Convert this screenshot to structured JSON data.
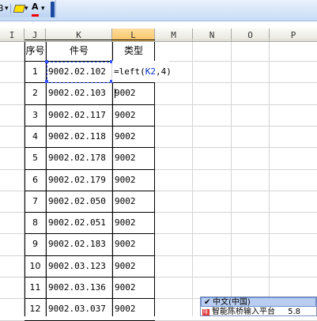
{
  "toolbar": {
    "left_label": "B",
    "font_color_letter": "A",
    "dropdown_arrow": "▾"
  },
  "columns": [
    "I",
    "J",
    "K",
    "L",
    "M",
    "N",
    "O",
    "P"
  ],
  "header_row": {
    "seq": "序号",
    "part": "件号",
    "type": "类型"
  },
  "rows": [
    {
      "seq": "1",
      "part": "9002.02.102",
      "type": ""
    },
    {
      "seq": "2",
      "part": "9002.02.103",
      "type": "9002"
    },
    {
      "seq": "3",
      "part": "9002.02.117",
      "type": "9002"
    },
    {
      "seq": "4",
      "part": "9002.02.118",
      "type": "9002"
    },
    {
      "seq": "5",
      "part": "9002.02.178",
      "type": "9002"
    },
    {
      "seq": "6",
      "part": "9002.02.179",
      "type": "9002"
    },
    {
      "seq": "7",
      "part": "9002.02.050",
      "type": "9002"
    },
    {
      "seq": "8",
      "part": "9002.02.051",
      "type": "9002"
    },
    {
      "seq": "9",
      "part": "9002.02.183",
      "type": "9002"
    },
    {
      "seq": "10",
      "part": "9002.03.123",
      "type": "9002"
    },
    {
      "seq": "11",
      "part": "9002.03.136",
      "type": "9002"
    },
    {
      "seq": "12",
      "part": "9002.03.037",
      "type": "9002"
    }
  ],
  "formula": {
    "prefix": "=left(",
    "ref": "K2",
    "suffix": ",4)"
  },
  "ime": {
    "check": "✔",
    "selected": "中文(中国)",
    "second": "智能陈桥输入平台",
    "version": "5.8",
    "logo": "陈"
  },
  "colors": {
    "active_header": "#f7c262",
    "selection": "#3355ff",
    "ref_text": "#0033cc"
  }
}
